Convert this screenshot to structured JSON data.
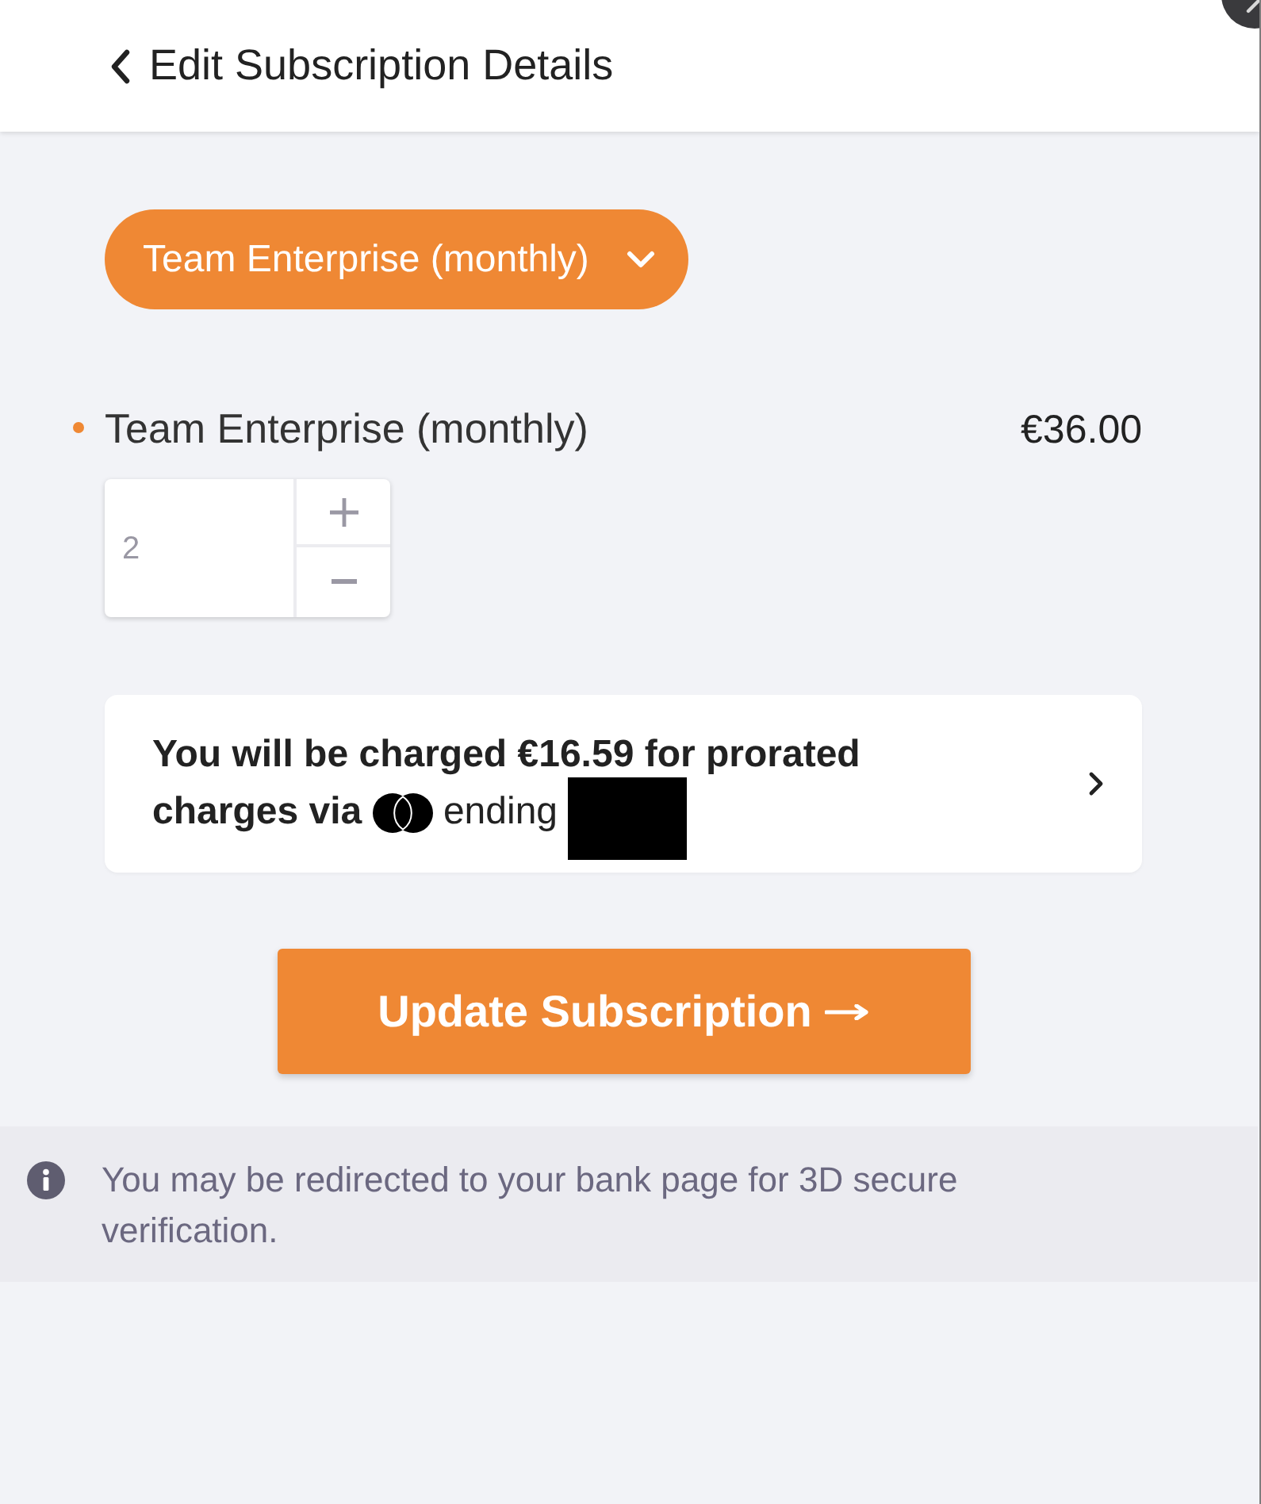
{
  "header": {
    "title": "Edit Subscription Details"
  },
  "plan_selector": {
    "value": "Team Enterprise (monthly)"
  },
  "line_items": [
    {
      "name": "Team Enterprise (monthly)",
      "price": "€36.00",
      "quantity": "2"
    }
  ],
  "charge_notice": {
    "text": "You will be charged €16.59 for prorated charges via",
    "card_text": "ending"
  },
  "submit_button": {
    "label": "Update Subscription"
  },
  "info_banner": {
    "text": "You may be redirected to your bank page for 3D secure verification."
  }
}
